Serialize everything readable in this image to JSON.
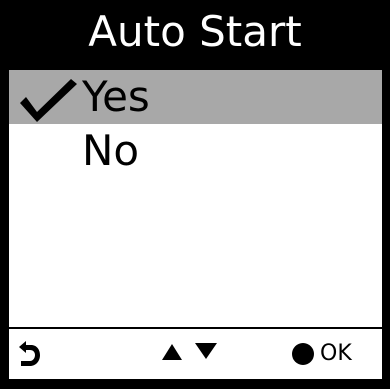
{
  "header": {
    "title": "Auto Start"
  },
  "menu": {
    "options": [
      {
        "label": "Yes",
        "selected": true,
        "icon": "checkmark-icon"
      },
      {
        "label": "No",
        "selected": false
      }
    ],
    "selection_color": "#a8a8a8"
  },
  "footer": {
    "back_icon": "back-arrow-icon",
    "nav_icons": [
      "up-triangle-icon",
      "down-triangle-icon"
    ],
    "ok_icon": "filled-circle-icon",
    "ok_label": "OK"
  }
}
